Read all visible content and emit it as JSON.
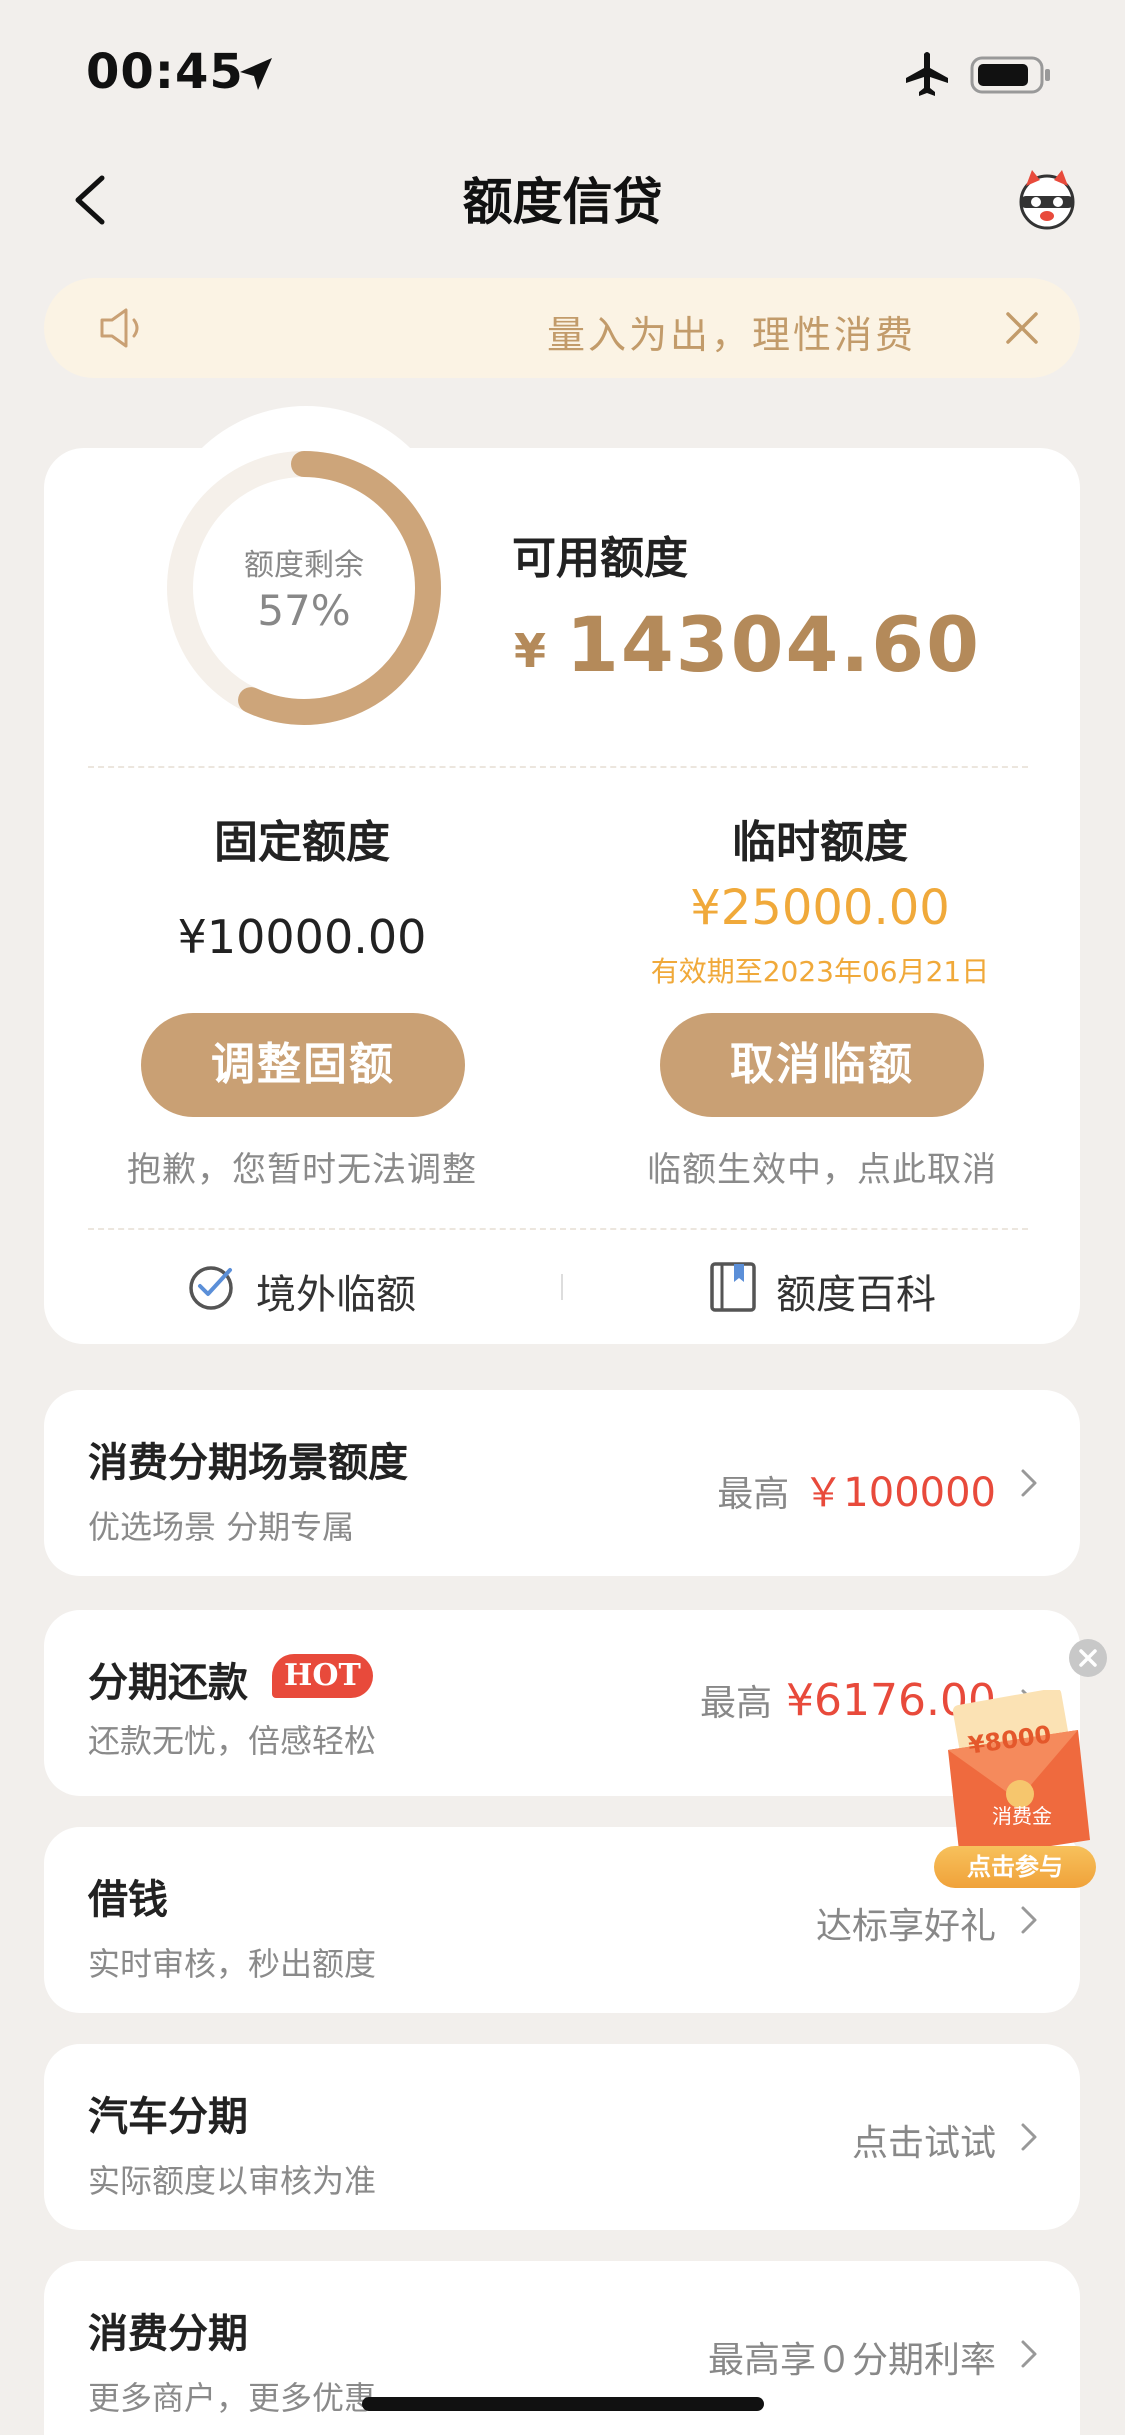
{
  "status_bar": {
    "time": "00:45"
  },
  "header": {
    "title": "额度信贷"
  },
  "notice": {
    "text": "量入为出，理性消费"
  },
  "credit": {
    "ring_label": "额度剩余",
    "ring_value": "57%",
    "ring_fraction": 0.57,
    "available_label": "可用额度",
    "available_currency": "¥",
    "available_amount": "14304.60",
    "fixed": {
      "title": "固定额度",
      "amount": "¥10000.00",
      "button": "调整固额",
      "note": "抱歉，您暂时无法调整"
    },
    "temporary": {
      "title": "临时额度",
      "amount": "¥25000.00",
      "expiry": "有效期至2023年06月21日",
      "button": "取消临额",
      "note": "临额生效中，点此取消"
    },
    "links": [
      {
        "label": "境外临额",
        "icon": "globe-plane-icon"
      },
      {
        "label": "额度百科",
        "icon": "book-icon"
      }
    ]
  },
  "services": [
    {
      "title": "消费分期场景额度",
      "subtitle": "优选场景 分期专属",
      "right_prefix": "最高",
      "right_value": "￥100000"
    },
    {
      "title": "分期还款",
      "badge": "HOT",
      "subtitle": "还款无忧，倍感轻松",
      "right_prefix": "最高",
      "right_value": "¥6176.00"
    },
    {
      "title": "借钱",
      "subtitle": "实时审核，秒出额度",
      "right_text": "达标享好礼"
    },
    {
      "title": "汽车分期",
      "subtitle": "实际额度以审核为准",
      "right_text": "点击试试"
    },
    {
      "title": "消费分期",
      "subtitle": "更多商户，更多优惠",
      "right_text": "最高享０分期利率"
    }
  ],
  "promo": {
    "amount": "¥8000",
    "subtitle": "消费金",
    "cta": "点击参与"
  },
  "colors": {
    "accent_gold": "#b48a5a",
    "button_gold": "#c9a074",
    "temp_orange": "#f0a93a",
    "price_red": "#e84a3b",
    "background": "#f2efec"
  }
}
